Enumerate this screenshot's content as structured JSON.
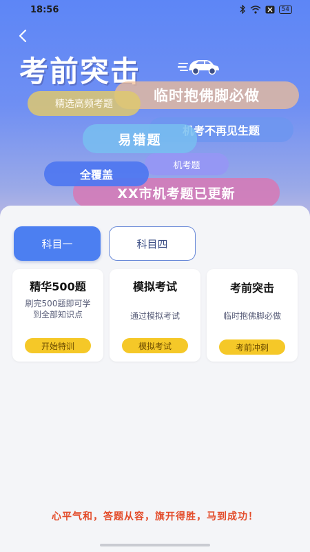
{
  "status_bar": {
    "time": "18:56",
    "battery": "54"
  },
  "header": {
    "title": "考前突击"
  },
  "bubbles": [
    {
      "text": "临时抱佛脚必做"
    },
    {
      "text": "精选高频考题"
    },
    {
      "text": "机考不再见生题"
    },
    {
      "text": "易错题"
    },
    {
      "text": "机考题"
    },
    {
      "text": "全覆盖"
    },
    {
      "text": "XX市机考题已更新"
    }
  ],
  "tabs": [
    {
      "label": "科目一",
      "active": true
    },
    {
      "label": "科目四",
      "active": false
    }
  ],
  "cards": [
    {
      "title": "精华500题",
      "desc": "刷完500题即可学到全部知识点",
      "button": "开始特训"
    },
    {
      "title": "模拟考试",
      "desc": "通过模拟考试",
      "button": "模拟考试"
    },
    {
      "title": "考前突击",
      "desc": "临时抱佛脚必做",
      "button": "考前冲刺"
    }
  ],
  "footer": {
    "motto": "心平气和，答题从容，旗开得胜，马到成功！"
  },
  "colors": {
    "primary": "#4c7ff1",
    "accent_yellow": "#f5c828",
    "motto_red": "#e34c2a"
  }
}
